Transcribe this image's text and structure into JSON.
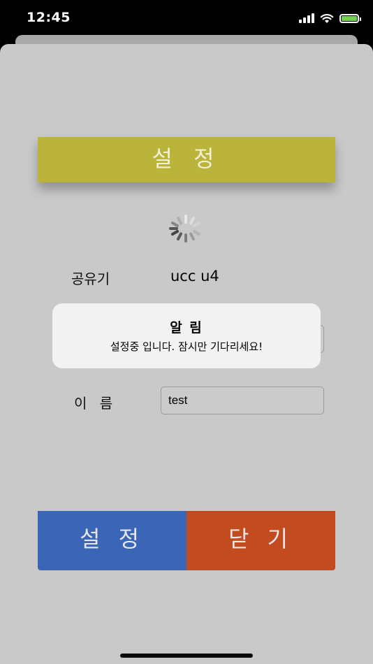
{
  "status_bar": {
    "time": "12:45"
  },
  "header": {
    "title": "설 정"
  },
  "form": {
    "router_label": "공유기",
    "router_value": "ucc u4",
    "name_label": "이 름",
    "name_value": "test"
  },
  "buttons": {
    "set_label": "설 정",
    "close_label": "닫 기"
  },
  "alert": {
    "title": "알 림",
    "message": "설정중 입니다. 잠시만 기다리세요!"
  },
  "colors": {
    "header": "#bab43a",
    "set_button": "#3b66b8",
    "close_button": "#c24b1f",
    "background": "#c9c9c9",
    "battery": "#6fd14d"
  }
}
